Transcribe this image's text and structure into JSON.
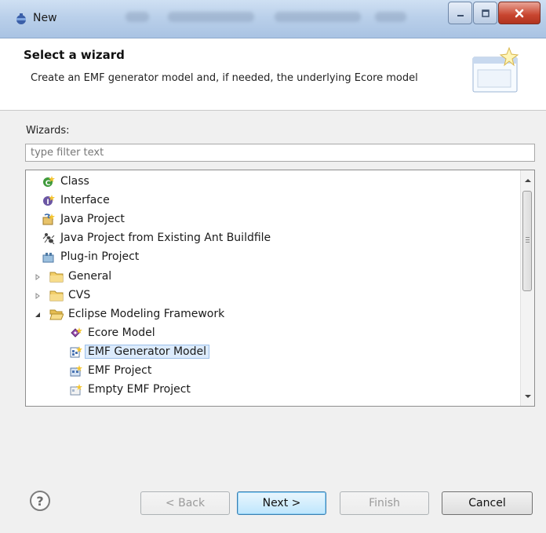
{
  "window": {
    "title": "New",
    "controls": {
      "minimize": "minimize-icon",
      "maximize": "maximize-icon",
      "close": "close-icon"
    }
  },
  "banner": {
    "title": "Select a wizard",
    "description": "Create an EMF generator model and, if needed, the underlying Ecore model"
  },
  "wizards": {
    "label": "Wizards:",
    "filter_placeholder": "type filter text",
    "items": [
      {
        "label": "Class",
        "icon": "class-icon"
      },
      {
        "label": "Interface",
        "icon": "interface-icon"
      },
      {
        "label": "Java Project",
        "icon": "java-project-icon"
      },
      {
        "label": "Java Project from Existing Ant Buildfile",
        "icon": "ant-icon"
      },
      {
        "label": "Plug-in Project",
        "icon": "plugin-project-icon"
      },
      {
        "label": "General",
        "icon": "folder-icon",
        "expanded": false
      },
      {
        "label": "CVS",
        "icon": "folder-icon",
        "expanded": false
      },
      {
        "label": "Eclipse Modeling Framework",
        "icon": "folder-open-icon",
        "expanded": true
      },
      {
        "label": "Ecore Model",
        "icon": "ecore-model-icon"
      },
      {
        "label": "EMF Generator Model",
        "icon": "emf-generator-icon",
        "selected": true
      },
      {
        "label": "EMF Project",
        "icon": "emf-project-icon"
      },
      {
        "label": "Empty EMF Project",
        "icon": "empty-emf-project-icon"
      }
    ]
  },
  "buttons": {
    "back": "< Back",
    "next": "Next >",
    "finish": "Finish",
    "cancel": "Cancel"
  },
  "colors": {
    "selection": "#dcebfc",
    "titlebar": "#bad0ea",
    "close": "#c8452f"
  }
}
